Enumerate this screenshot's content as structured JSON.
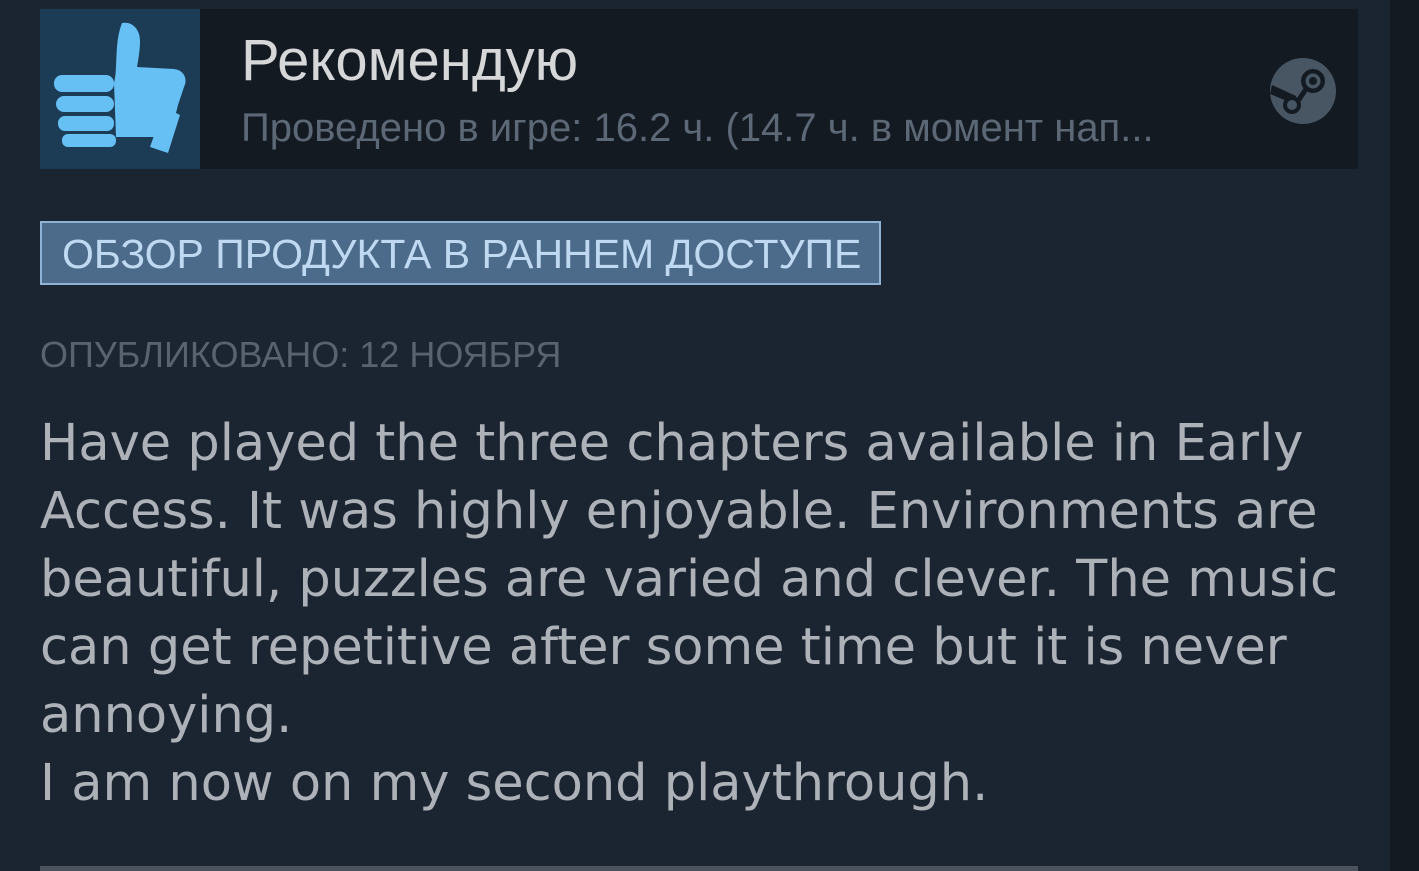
{
  "review": {
    "verdict": "Рекомендую",
    "hours_line": "Проведено в игре: 16.2 ч. (14.7 ч. в момент нап...",
    "early_access_badge": "ОБЗОР ПРОДУКТА В РАННЕМ ДОСТУПЕ",
    "posted": "ОПУБЛИКОВАНО: 12 НОЯБРЯ",
    "body": [
      "Have played the three chapters available in Early Access. It was highly enjoyable. Environments are beautiful, puzzles are varied and clever. The music can get repetitive after some time but it is never annoying.",
      "I am now on my second playthrough."
    ]
  },
  "icons": {
    "verdict_icon": "thumbs-up-icon",
    "platform_icon": "steam-logo-icon"
  },
  "colors": {
    "thumb_blue": "#66c0f4",
    "thumb_bg": "#1c3b55",
    "badge_bg": "#4c6b8a",
    "badge_border": "#90b2d4",
    "card_bg": "#1b2431"
  }
}
